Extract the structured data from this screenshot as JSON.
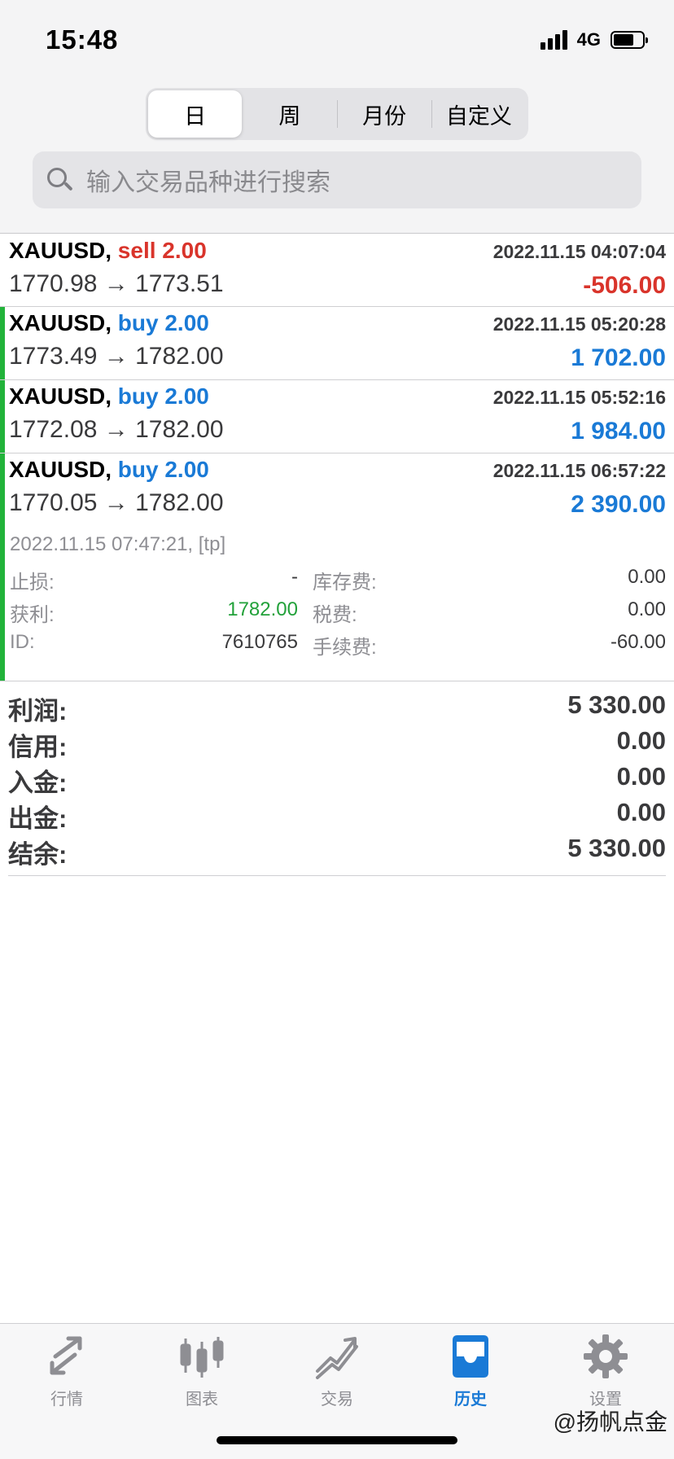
{
  "status_bar": {
    "time": "15:48",
    "network": "4G"
  },
  "period_tabs": [
    {
      "label": "日",
      "active": true
    },
    {
      "label": "周",
      "active": false
    },
    {
      "label": "月份",
      "active": false
    },
    {
      "label": "自定义",
      "active": false
    }
  ],
  "search": {
    "placeholder": "输入交易品种进行搜索"
  },
  "trades": [
    {
      "symbol": "XAUUSD,",
      "side": "sell 2.00",
      "time": "2022.11.15 04:07:04",
      "prices": "1770.98 → 1773.51",
      "profit": "-506.00"
    },
    {
      "symbol": "XAUUSD,",
      "side": "buy 2.00",
      "time": "2022.11.15 05:20:28",
      "prices": "1773.49 → 1782.00",
      "profit": "1 702.00"
    },
    {
      "symbol": "XAUUSD,",
      "side": "buy 2.00",
      "time": "2022.11.15 05:52:16",
      "prices": "1772.08 → 1782.00",
      "profit": "1 984.00"
    },
    {
      "symbol": "XAUUSD,",
      "side": "buy 2.00",
      "time": "2022.11.15 06:57:22",
      "prices": "1770.05 → 1782.00",
      "profit": "2 390.00"
    }
  ],
  "trade_details": {
    "close_info": "2022.11.15 07:47:21, [tp]",
    "stop_loss_label": "止损:",
    "stop_loss": "-",
    "swap_label": "库存费:",
    "swap": "0.00",
    "take_profit_label": "获利:",
    "take_profit": "1782.00",
    "tax_label": "税费:",
    "tax": "0.00",
    "id_label": "ID:",
    "id": "7610765",
    "commission_label": "手续费:",
    "commission": "-60.00"
  },
  "summary": {
    "profit_label": "利润:",
    "profit": "5 330.00",
    "credit_label": "信用:",
    "credit": "0.00",
    "deposit_label": "入金:",
    "deposit": "0.00",
    "withdrawal_label": "出金:",
    "withdrawal": "0.00",
    "balance_label": "结余:",
    "balance": "5 330.00"
  },
  "tab_bar": [
    {
      "label": "行情",
      "icon": "quotes-arrows-icon"
    },
    {
      "label": "图表",
      "icon": "candlestick-chart-icon"
    },
    {
      "label": "交易",
      "icon": "trade-chart-icon"
    },
    {
      "label": "历史",
      "icon": "history-inbox-icon",
      "active": true
    },
    {
      "label": "设置",
      "icon": "gear-icon"
    }
  ],
  "watermark": "@扬帆点金",
  "colors": {
    "sell": "#d9342b",
    "buy": "#1a7ad6",
    "accent": "#1a7ad6",
    "green": "#22b33a"
  }
}
